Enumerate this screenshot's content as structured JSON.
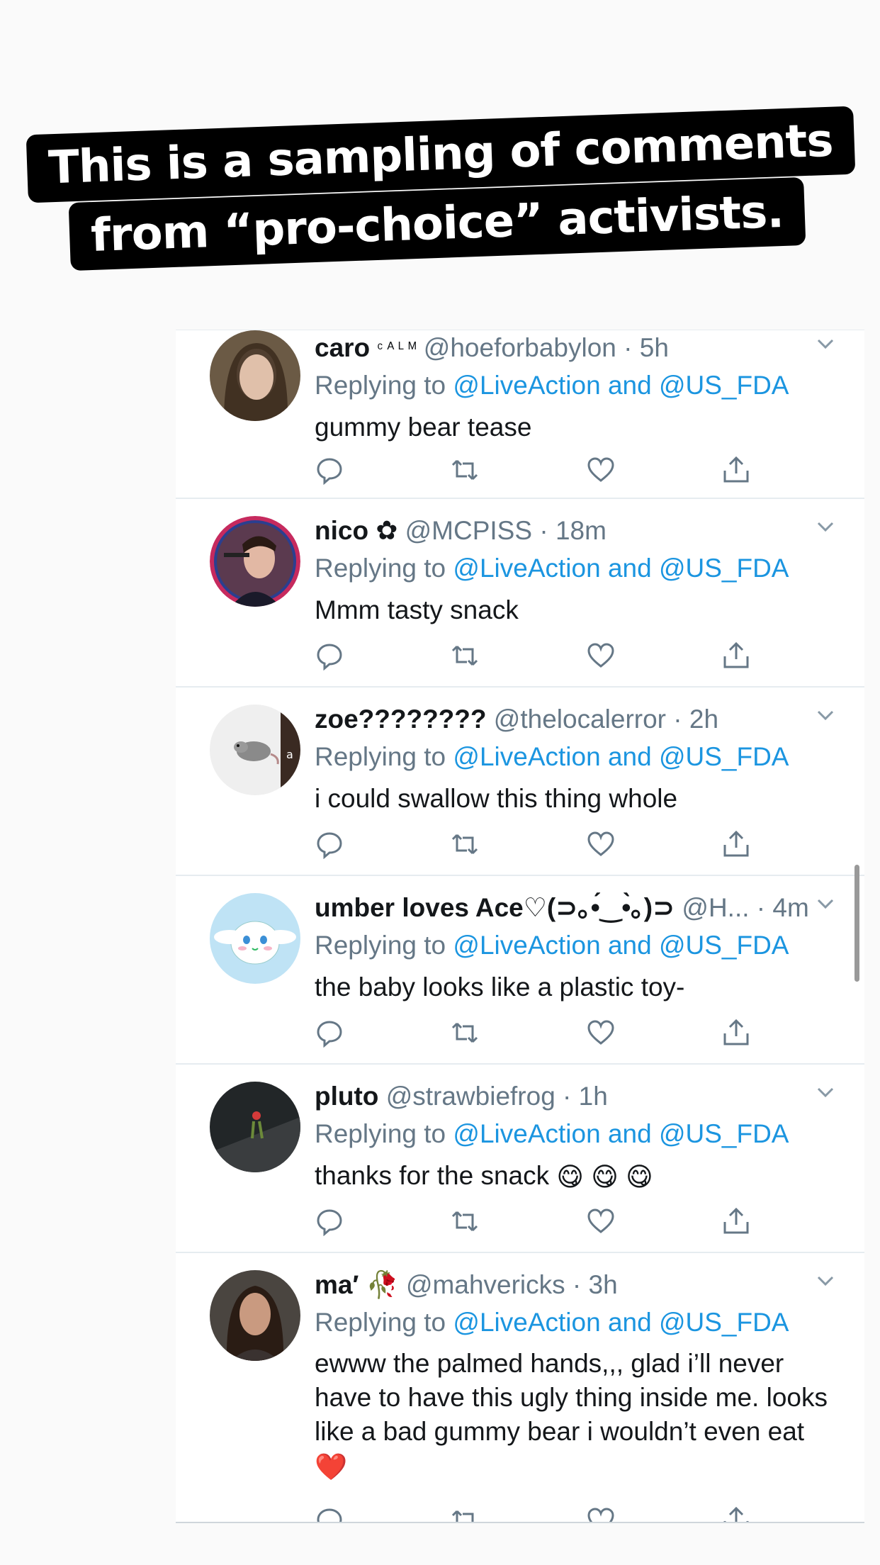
{
  "banner": {
    "line1": "This is a sampling of comments",
    "line2": "from “pro-choice” activists."
  },
  "colors": {
    "banner_bg": "#000000",
    "link": "#1b95e0",
    "muted": "#657786",
    "text": "#14171a"
  },
  "tweets": [
    {
      "name": "caro",
      "name_suffix": "ᶜ ᴬ ᴸ ᴹ",
      "handle": "@hoeforbabylon",
      "time": "5h",
      "replying_prefix": "Replying to",
      "replying_to": "@LiveAction and @US_FDA",
      "text": "gummy bear tease"
    },
    {
      "name": "nico ✿",
      "name_suffix": "",
      "handle": "@MCPISS",
      "time": "18m",
      "replying_prefix": "Replying to",
      "replying_to": "@LiveAction and @US_FDA",
      "text": "Mmm tasty snack"
    },
    {
      "name": "zoe????????",
      "name_suffix": "",
      "handle": "@thelocalerror",
      "time": "2h",
      "replying_prefix": "Replying to",
      "replying_to": "@LiveAction and @US_FDA",
      "text": "i could swallow this thing whole"
    },
    {
      "name": "umber loves Ace♡(⊃｡•́‿•̀｡)⊃",
      "name_suffix": "",
      "handle": "@H...",
      "time": "4m",
      "replying_prefix": "Replying to",
      "replying_to": "@LiveAction and @US_FDA",
      "text": "the baby looks like a plastic toy-"
    },
    {
      "name": "pluto",
      "name_suffix": "",
      "handle": "@strawbiefrog",
      "time": "1h",
      "replying_prefix": "Replying to",
      "replying_to": "@LiveAction and @US_FDA",
      "text": "thanks for the snack",
      "emoji": "😋 😋 😋"
    },
    {
      "name": "ma′",
      "name_suffix": "🥀",
      "handle": "@mahvericks",
      "time": "3h",
      "replying_prefix": "Replying to",
      "replying_to": "@LiveAction and @US_FDA",
      "text": "ewww the palmed hands,,, glad i’ll never have to have this ugly thing inside me. looks like a bad gummy bear i wouldn’t even eat",
      "emoji": "❤️"
    }
  ]
}
